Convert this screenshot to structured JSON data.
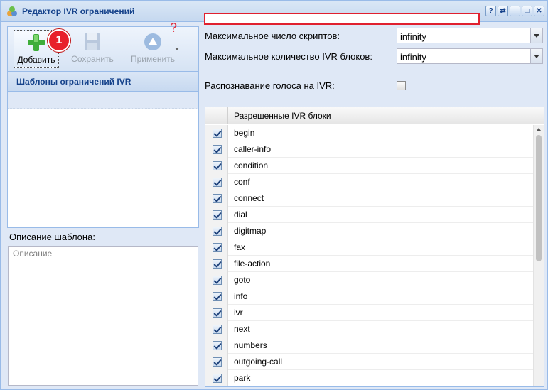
{
  "window": {
    "title": "Редактор IVR ограничений",
    "tools": [
      "?",
      "⇄",
      "–",
      "□",
      "✕"
    ]
  },
  "toolbar": {
    "add_label": "Добавить",
    "save_label": "Сохранить",
    "apply_label": "Применить",
    "badge": "1",
    "question_mark": "?"
  },
  "templates": {
    "header": "Шаблоны ограничений IVR"
  },
  "description": {
    "label": "Описание шаблона:",
    "placeholder": "Описание"
  },
  "settings": {
    "max_scripts_label": "Максимальное число скриптов:",
    "max_scripts_value": "infinity",
    "max_blocks_label": "Максимальное количество IVR блоков:",
    "max_blocks_value": "infinity",
    "voice_recognition_label": "Распознавание голоса на IVR:",
    "voice_recognition_checked": false
  },
  "blocks_grid": {
    "header": "Разрешенные IVR блоки",
    "rows": [
      {
        "name": "begin",
        "checked": true
      },
      {
        "name": "caller-info",
        "checked": true
      },
      {
        "name": "condition",
        "checked": true
      },
      {
        "name": "conf",
        "checked": true
      },
      {
        "name": "connect",
        "checked": true
      },
      {
        "name": "dial",
        "checked": true
      },
      {
        "name": "digitmap",
        "checked": true
      },
      {
        "name": "fax",
        "checked": true
      },
      {
        "name": "file-action",
        "checked": true
      },
      {
        "name": "goto",
        "checked": true
      },
      {
        "name": "info",
        "checked": true
      },
      {
        "name": "ivr",
        "checked": true
      },
      {
        "name": "next",
        "checked": true
      },
      {
        "name": "numbers",
        "checked": true
      },
      {
        "name": "outgoing-call",
        "checked": true
      },
      {
        "name": "park",
        "checked": true
      }
    ]
  },
  "colors": {
    "accent": "#15428b",
    "highlight_red": "#e0202f",
    "panel_bg": "#dfe8f6"
  }
}
